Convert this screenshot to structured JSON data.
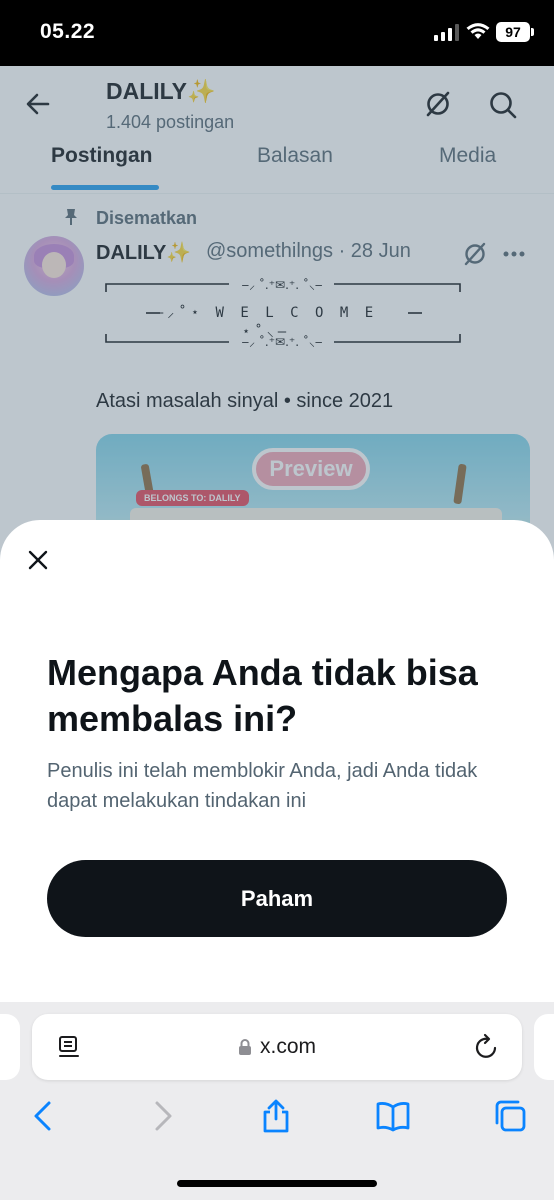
{
  "status_bar": {
    "time": "05.22",
    "battery": "97"
  },
  "profile_header": {
    "name": "DALILY",
    "name_emoji": "✨",
    "post_count": "1.404 postingan"
  },
  "tabs": [
    {
      "label": "Postingan",
      "active": true
    },
    {
      "label": "Balasan",
      "active": false
    },
    {
      "label": "Media",
      "active": false
    }
  ],
  "pinned_post": {
    "pinned_label": "Disematkan",
    "author_name": "DALILY",
    "author_emoji": "✨",
    "handle_date": "@somethilngs · 28 Jun",
    "ascii_art": {
      "top": "┌──────────‒⸝ ˚.⁺✉︎.⁺. ˚⸜‒──────────┐",
      "middle": "‒⸝˚⋆ W E L C O M E ⋆˚⸜‒",
      "bottom": "└──────────‒⸝ ˚.⁺✉︎.⁺. ˚⸜‒──────────┘"
    },
    "text": "Atasi masalah sinyal • since 2021",
    "media": {
      "preview_label": "Preview",
      "belongs_label": "BELONGS TO: DALILY"
    }
  },
  "sheet": {
    "title": "Mengapa Anda tidak bisa membalas ini?",
    "description": "Penulis ini telah memblokir Anda, jadi Anda tidak dapat melakukan tindakan ini",
    "button_label": "Paham"
  },
  "browser": {
    "url": "x.com"
  },
  "colors": {
    "accent": "#1d9bf0",
    "text": "#0f1419",
    "secondary": "#536471",
    "button_bg": "#0f1419",
    "safari_blue": "#0a84ff"
  }
}
